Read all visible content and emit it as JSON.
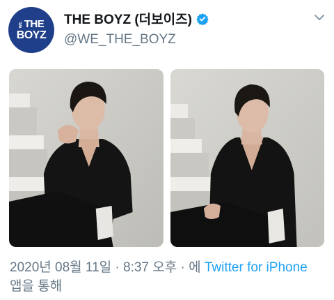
{
  "account": {
    "avatar_logo_prefix": "WE",
    "avatar_logo_top": "THE",
    "avatar_logo_bottom": "BOYZ",
    "display_name": "THE BOYZ (더보이즈)",
    "handle": "@WE_THE_BOYZ",
    "verified": true
  },
  "icons": {
    "verified": "verified-badge-icon",
    "menu": "chevron-down-icon"
  },
  "media": {
    "photo_count": 2
  },
  "meta": {
    "timestamp": "2020년 08월 11일 · 8:37 오후 · 에",
    "source_link": "Twitter for iPhone",
    "suffix": "앱을 통해"
  },
  "colors": {
    "avatar_bg": "#1f3f8a",
    "verified_blue": "#1da1f2",
    "link_blue": "#1da1f2",
    "secondary_text": "#657786"
  }
}
